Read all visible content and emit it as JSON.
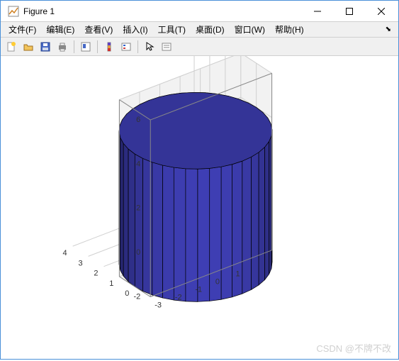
{
  "window": {
    "title": "Figure 1"
  },
  "menubar": {
    "items": [
      {
        "label": "文件(F)"
      },
      {
        "label": "编辑(E)"
      },
      {
        "label": "查看(V)"
      },
      {
        "label": "插入(I)"
      },
      {
        "label": "工具(T)"
      },
      {
        "label": "桌面(D)"
      },
      {
        "label": "窗口(W)"
      },
      {
        "label": "帮助(H)"
      }
    ]
  },
  "toolbar": {
    "icons": [
      "new-figure-icon",
      "open-icon",
      "save-icon",
      "print-icon",
      "sep",
      "datacursor-icon",
      "sep",
      "colorbar-icon",
      "legend-icon",
      "sep",
      "pointer-icon",
      "edit-plot-icon"
    ]
  },
  "chart_data": {
    "type": "surface3d",
    "shape": "cylinder",
    "cylinder": {
      "radius": 3,
      "height": 6,
      "z_base": -2,
      "z_top": 4,
      "face_color": "#3a3aa8"
    },
    "xlim": [
      -3,
      3
    ],
    "ylim": [
      -1,
      1
    ],
    "zlim": [
      -2,
      6
    ],
    "xticks": [
      -3,
      -2,
      -1,
      0,
      1
    ],
    "yticks": [
      0,
      1,
      2,
      3,
      4
    ],
    "zticks": [
      -2,
      0,
      2,
      4,
      6
    ],
    "view": {
      "azimuth": -37.5,
      "elevation": 30
    }
  },
  "watermark": "CSDN @不牌不改"
}
